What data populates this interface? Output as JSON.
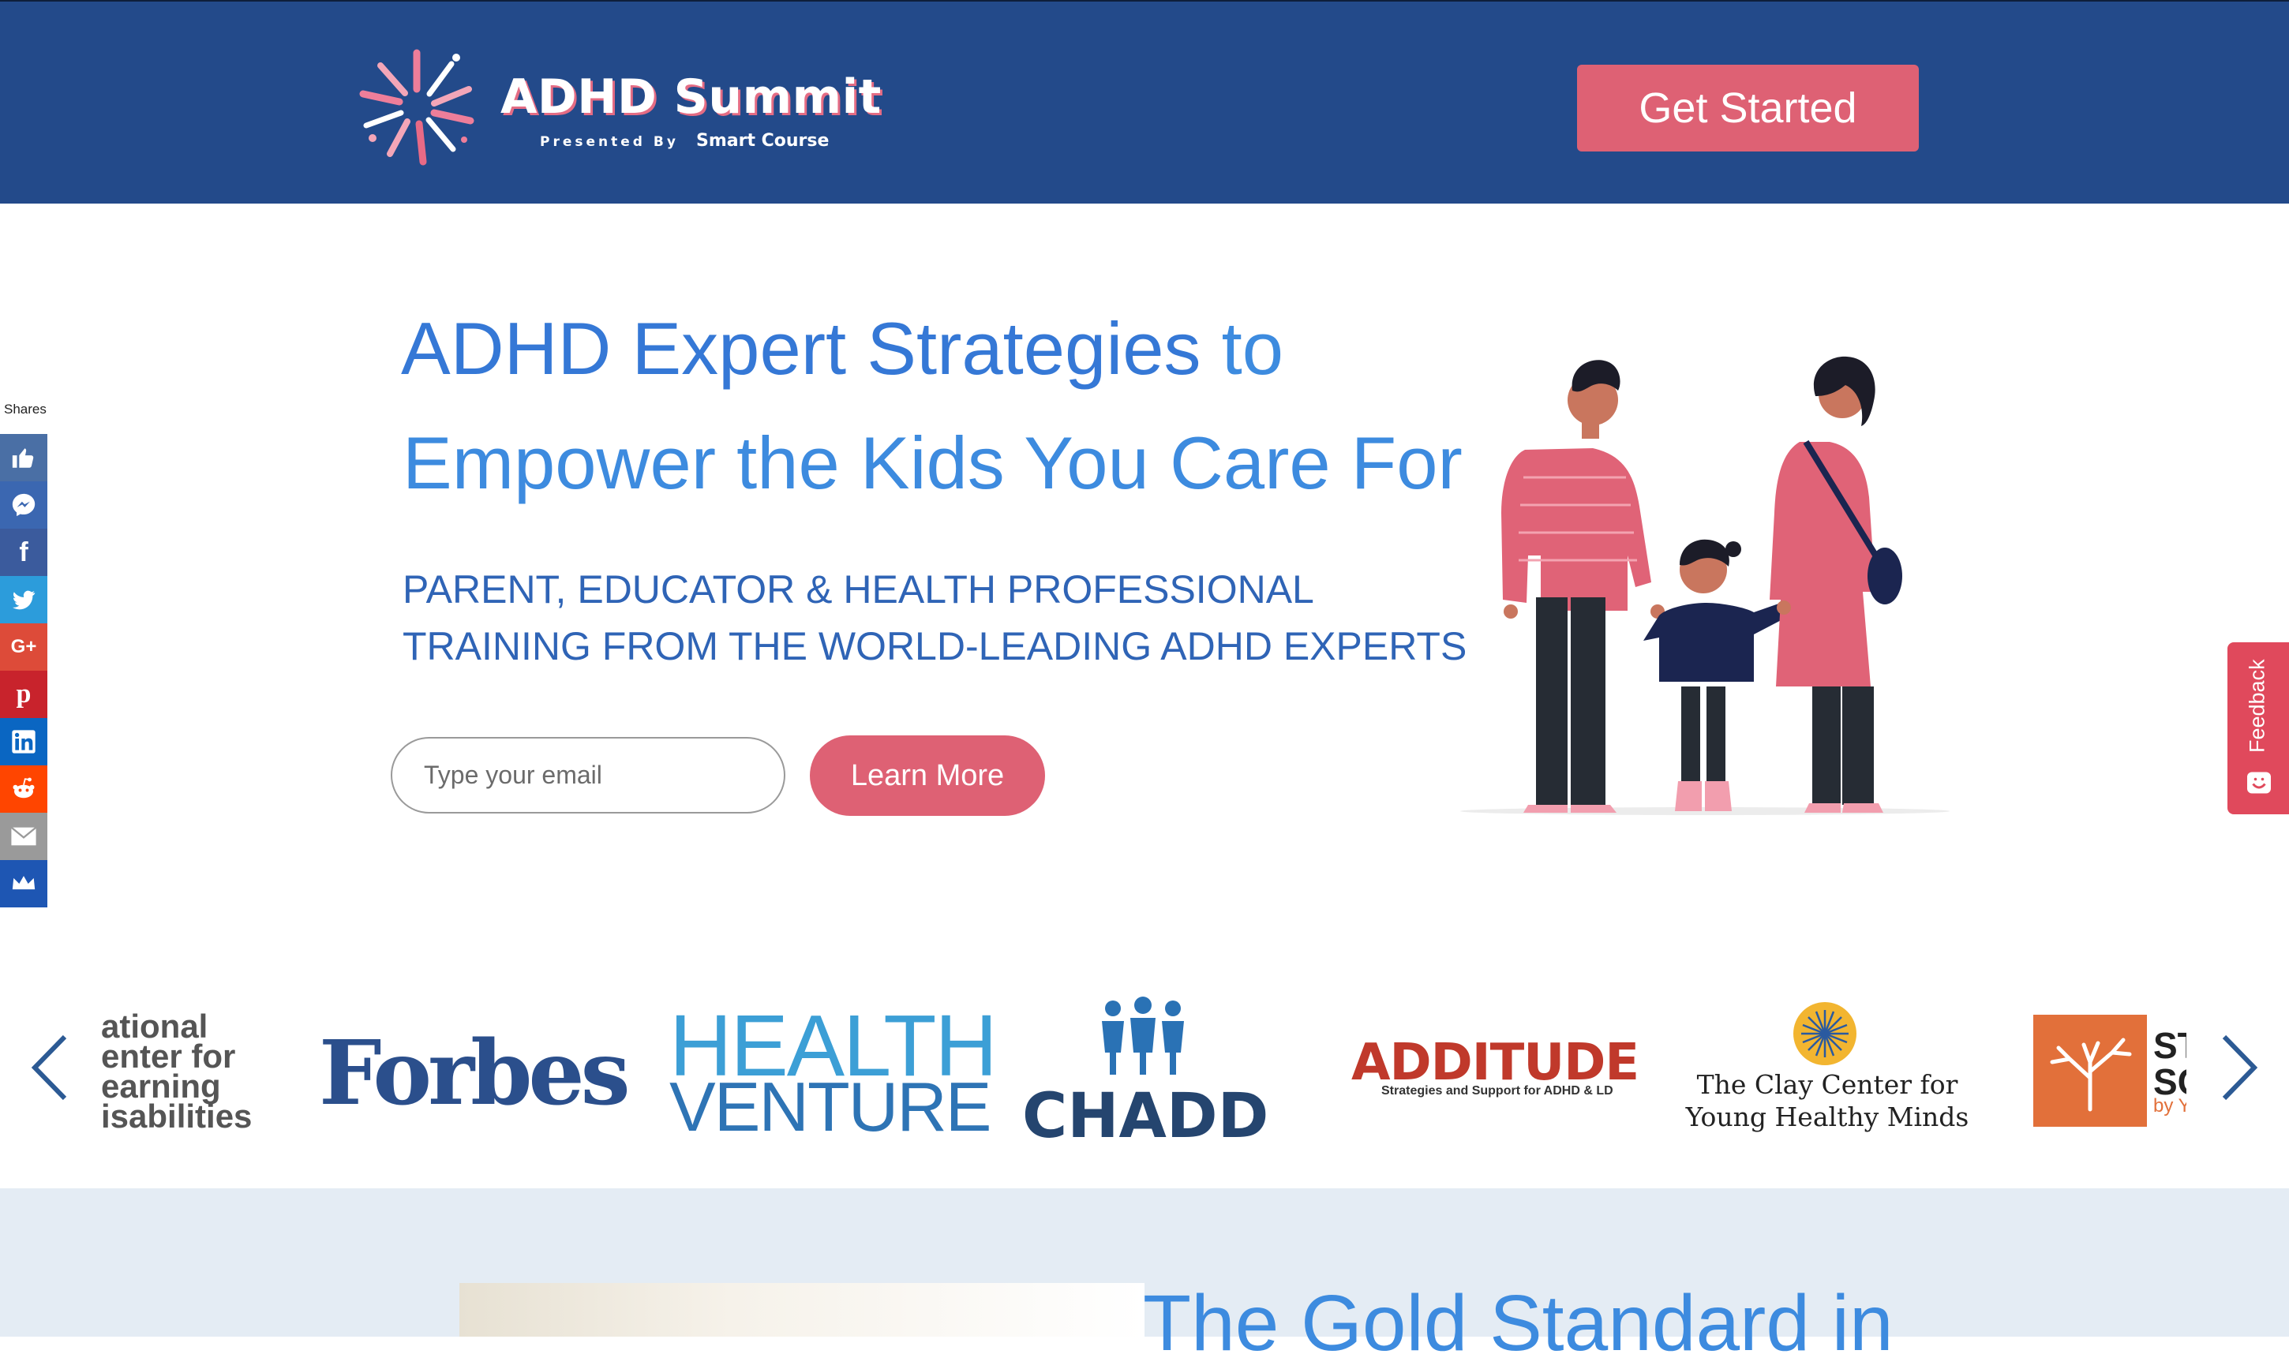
{
  "header": {
    "logo_title": "ADHD Summit",
    "logo_presented": "Presented By",
    "logo_brand": "Smart Course",
    "cta_label": "Get Started"
  },
  "hero": {
    "title_line1_strong": "ADHD Expert Strategies",
    "title_line1_rest": " to",
    "title_line2": "Empower the Kids You Care For",
    "subtitle_line1": "PARENT, EDUCATOR & HEALTH PROFESSIONAL",
    "subtitle_line2": "TRAINING FROM THE WORLD-LEADING ADHD EXPERTS",
    "email_placeholder": "Type your email",
    "learn_more_label": "Learn More"
  },
  "share_bar": {
    "label": "Shares",
    "buttons": [
      {
        "name": "like",
        "icon": "thumbs-up-icon",
        "color": "#4a6fa5"
      },
      {
        "name": "messenger",
        "icon": "messenger-icon",
        "color": "#3b67b1"
      },
      {
        "name": "facebook",
        "icon": "facebook-icon",
        "color": "#3b5b9d"
      },
      {
        "name": "twitter",
        "icon": "twitter-icon",
        "color": "#2c9cdb"
      },
      {
        "name": "google-plus",
        "icon": "google-plus-icon",
        "color": "#dd4b39"
      },
      {
        "name": "pinterest",
        "icon": "pinterest-icon",
        "color": "#c8232c"
      },
      {
        "name": "linkedin",
        "icon": "linkedin-icon",
        "color": "#0a66c2"
      },
      {
        "name": "reddit",
        "icon": "reddit-icon",
        "color": "#ff4500"
      },
      {
        "name": "email",
        "icon": "envelope-icon",
        "color": "#9a9a9a"
      },
      {
        "name": "sumo",
        "icon": "crown-icon",
        "color": "#1e56b3"
      }
    ]
  },
  "feedback": {
    "label": "Feedback"
  },
  "logos": {
    "ncld": [
      "ational",
      "enter for",
      "earning",
      "isabilities"
    ],
    "forbes": "Forbes",
    "health_venture": [
      "HEALTH",
      "VENTURE"
    ],
    "chadd": "CHADD",
    "additude": "ADDITUDE",
    "additude_tagline": "Strategies and Support for ADHD & LD",
    "clay_center": [
      "The Clay Center for",
      "Young Healthy Minds"
    ],
    "st_partial": [
      "ST",
      "SC"
    ],
    "st_by": "by Y"
  },
  "section2": {
    "heading_partial": "The Gold Standard in"
  },
  "colors": {
    "header_bg": "#234a8a",
    "accent_pink": "#de6174",
    "hero_blue": "#3d8bdf",
    "sub_blue": "#2f64b6",
    "section_bg": "#e4ecf4"
  }
}
